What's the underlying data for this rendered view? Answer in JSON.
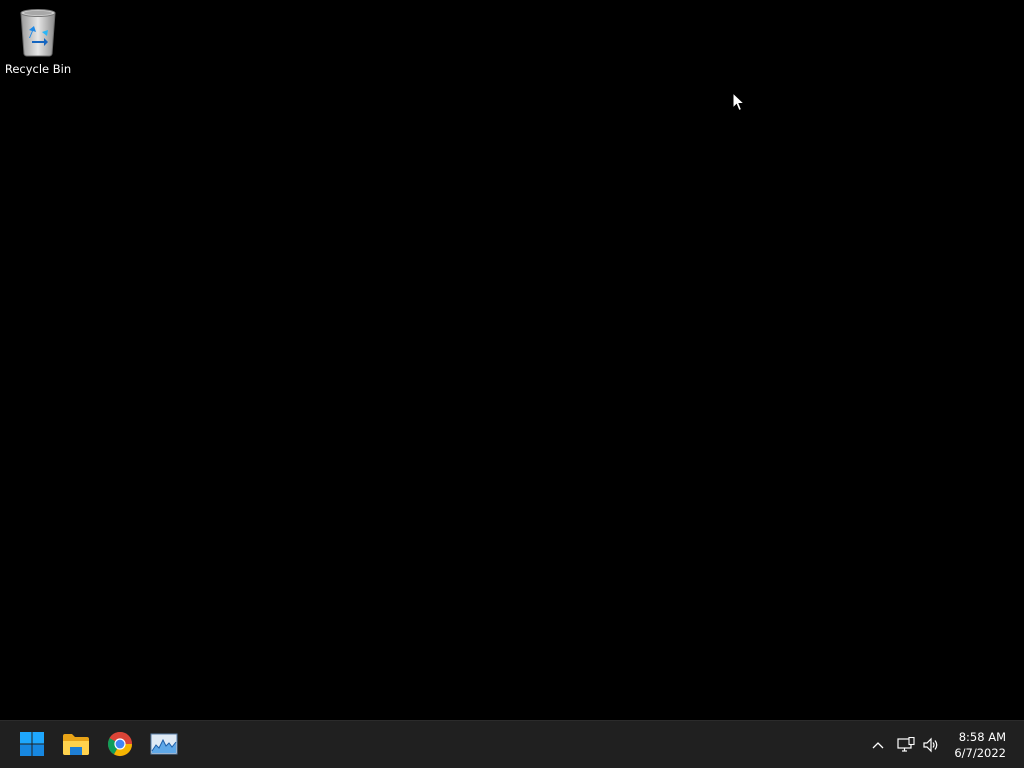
{
  "desktop": {
    "background_color": "#000000",
    "icons": [
      {
        "label": "Recycle Bin",
        "icon": "recycle-bin-icon"
      }
    ]
  },
  "taskbar": {
    "background_color": "#202020",
    "pinned": [
      {
        "name": "start",
        "icon": "windows-start-icon",
        "accent": "#1e90ff"
      },
      {
        "name": "file-explorer",
        "icon": "folder-icon",
        "accent": "#f4c430"
      },
      {
        "name": "chrome",
        "icon": "chrome-icon"
      },
      {
        "name": "resource-monitor",
        "icon": "performance-monitor-icon"
      }
    ],
    "tray": {
      "overflow_icon": "chevron-up-icon",
      "network_icon": "network-icon",
      "volume_icon": "volume-icon"
    },
    "clock": {
      "time": "8:58 AM",
      "date": "6/7/2022"
    }
  }
}
